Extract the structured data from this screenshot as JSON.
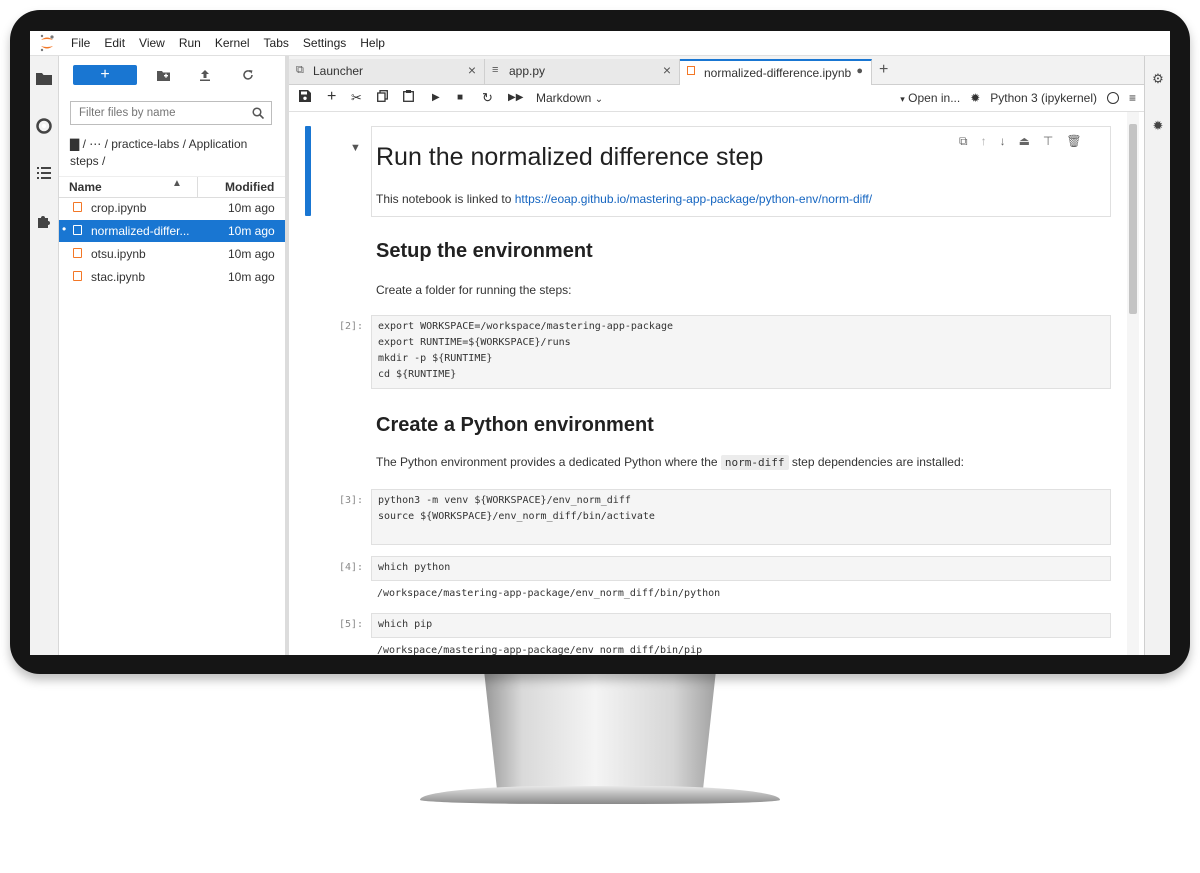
{
  "menubar": {
    "items": [
      "File",
      "Edit",
      "View",
      "Run",
      "Kernel",
      "Tabs",
      "Settings",
      "Help"
    ]
  },
  "filebrowser": {
    "new_label": "+",
    "filter_placeholder": "Filter files by name",
    "breadcrumb_line1": "▇ / ⋯ / practice-labs / Application",
    "breadcrumb_line2": "steps /",
    "col_name": "Name",
    "col_modified": "Modified",
    "files": [
      {
        "name": "crop.ipynb",
        "modified": "10m ago",
        "selected": false
      },
      {
        "name": "normalized-differ...",
        "modified": "10m ago",
        "selected": true
      },
      {
        "name": "otsu.ipynb",
        "modified": "10m ago",
        "selected": false
      },
      {
        "name": "stac.ipynb",
        "modified": "10m ago",
        "selected": false
      }
    ]
  },
  "tabs": [
    {
      "label": "Launcher",
      "icon": "external-link-icon"
    },
    {
      "label": "app.py",
      "icon": "text-file-icon"
    },
    {
      "label": "normalized-difference.ipynb",
      "icon": "notebook-icon",
      "active": true
    }
  ],
  "toolbar": {
    "cell_type": "Markdown",
    "open_in": "Open in...",
    "kernel_name": "Python 3 (ipykernel)"
  },
  "notebook": {
    "title": "Run the normalized difference step",
    "intro_text": "This notebook is linked to ",
    "intro_link": "https://eoap.github.io/mastering-app-package/python-env/norm-diff/",
    "setup_heading": "Setup the environment",
    "setup_text": "Create a folder for running the steps:",
    "cell2_prompt": "[2]:",
    "cell2_lines": [
      "export WORKSPACE=/workspace/mastering-app-package",
      "export RUNTIME=${WORKSPACE}/runs",
      "mkdir -p ${RUNTIME}",
      "cd ${RUNTIME}"
    ],
    "python_heading": "Create a Python environment",
    "python_text_before": "The Python environment provides a dedicated Python where the ",
    "python_text_code": "norm-diff",
    "python_text_after": " step dependencies are installed:",
    "cell3_prompt": "[3]:",
    "cell3_lines": [
      "python3 -m venv ${WORKSPACE}/env_norm_diff",
      "source ${WORKSPACE}/env_norm_diff/bin/activate"
    ],
    "cell4_prompt": "[4]:",
    "cell4_code": "which python",
    "cell4_output": "/workspace/mastering-app-package/env_norm_diff/bin/python",
    "cell5_prompt": "[5]:",
    "cell5_code": "which pip",
    "cell5_output": "/workspace/mastering-app-package/env_norm_diff/bin/pip"
  },
  "colors": {
    "accent": "#1976d2",
    "notebook_icon": "#f37726"
  }
}
